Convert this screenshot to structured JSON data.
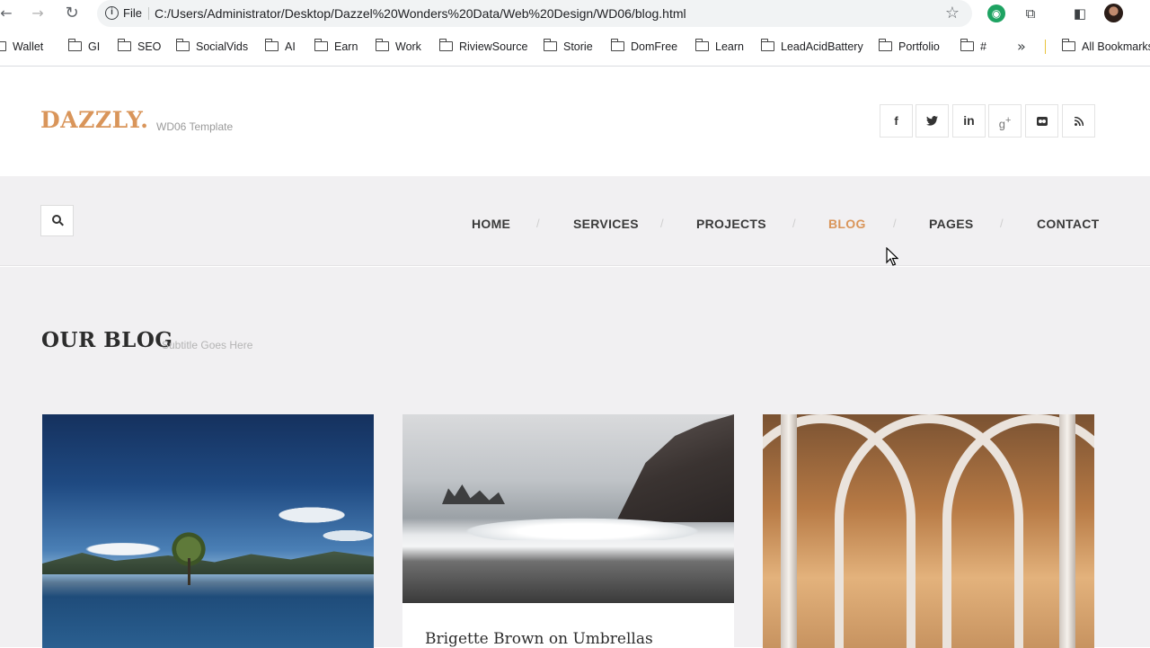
{
  "browser": {
    "back": "←",
    "forward": "→",
    "reload": "↻",
    "security_label": "File",
    "url": "C:/Users/Administrator/Desktop/Dazzel%20Wonders%20Data/Web%20Design/WD06/blog.html",
    "star": "☆",
    "bookmarks": [
      "Wallet",
      "GI",
      "SEO",
      "SocialVids",
      "AI",
      "Earn",
      "Work",
      "RiviewSource",
      "Storie",
      "DomFree",
      "Learn",
      "LeadAcidBattery",
      "Portfolio",
      "#"
    ],
    "more": "»",
    "all_bookmarks": "All Bookmarks"
  },
  "site": {
    "logo": "DAZZLY",
    "logo_dot": ".",
    "tagline": "WD06 Template",
    "social": [
      {
        "name": "facebook-icon",
        "glyph": "f"
      },
      {
        "name": "twitter-icon",
        "glyph": "t"
      },
      {
        "name": "linkedin-icon",
        "glyph": "in"
      },
      {
        "name": "google-plus-icon",
        "glyph": "g+"
      },
      {
        "name": "flickr-icon",
        "glyph": "●●"
      },
      {
        "name": "rss-icon",
        "glyph": "◝"
      }
    ],
    "accent_color": "#d9955a"
  },
  "nav": {
    "items": [
      "HOME",
      "SERVICES",
      "PROJECTS",
      "BLOG",
      "PAGES",
      "CONTACT"
    ],
    "separator": "/",
    "active": "BLOG"
  },
  "blog": {
    "title": "OUR BLOG",
    "subtitle": "Subtitle Goes Here",
    "cards": [
      {
        "image": "lake-tree-photo",
        "title": ""
      },
      {
        "image": "beach-cliff-photo",
        "title": "Brigette Brown on Umbrellas"
      },
      {
        "image": "cathedral-arches-photo",
        "title": ""
      }
    ]
  }
}
